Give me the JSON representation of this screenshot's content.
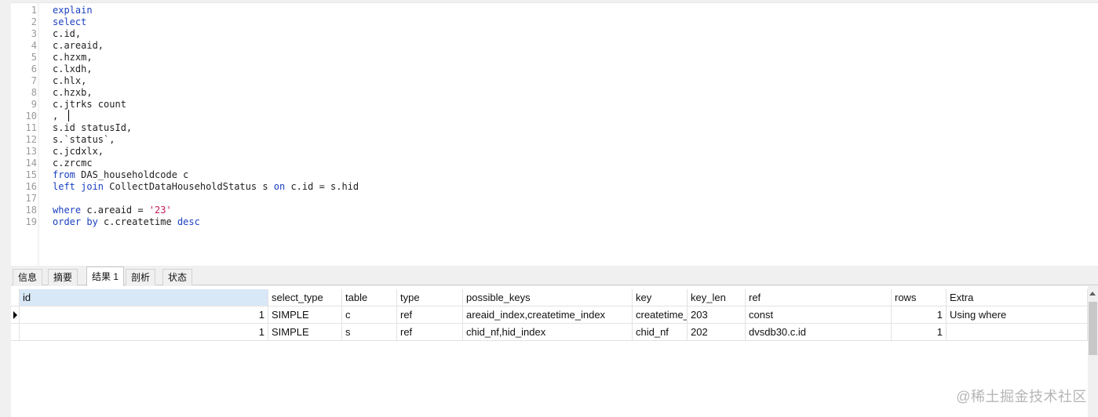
{
  "editor": {
    "line_numbers": [
      "1",
      "2",
      "3",
      "4",
      "5",
      "6",
      "7",
      "8",
      "9",
      "10",
      "11",
      "12",
      "13",
      "14",
      "15",
      "16",
      "17",
      "18",
      "19"
    ],
    "lines": [
      [
        {
          "t": "explain",
          "c": "kw"
        }
      ],
      [
        {
          "t": "select",
          "c": "kw"
        }
      ],
      [
        {
          "t": "c.id,",
          "c": ""
        }
      ],
      [
        {
          "t": "c.areaid,",
          "c": ""
        }
      ],
      [
        {
          "t": "c.hzxm,",
          "c": ""
        }
      ],
      [
        {
          "t": "c.lxdh,",
          "c": ""
        }
      ],
      [
        {
          "t": "c.hlx,",
          "c": ""
        }
      ],
      [
        {
          "t": "c.hzxb,",
          "c": ""
        }
      ],
      [
        {
          "t": "c.jtrks count",
          "c": ""
        }
      ],
      [
        {
          "t": ",",
          "c": ""
        }
      ],
      [
        {
          "t": "s.id statusId,",
          "c": ""
        }
      ],
      [
        {
          "t": "s.`status`,",
          "c": ""
        }
      ],
      [
        {
          "t": "c.jcdxlx,",
          "c": ""
        }
      ],
      [
        {
          "t": "c.zrcmc",
          "c": ""
        }
      ],
      [
        {
          "t": "from",
          "c": "kw"
        },
        {
          "t": " DAS_householdcode c",
          "c": ""
        }
      ],
      [
        {
          "t": "left join",
          "c": "kw"
        },
        {
          "t": " CollectDataHouseholdStatus s ",
          "c": ""
        },
        {
          "t": "on",
          "c": "kw"
        },
        {
          "t": " c.id = s.hid",
          "c": ""
        }
      ],
      [],
      [
        {
          "t": "where",
          "c": "kw"
        },
        {
          "t": " c.areaid = ",
          "c": ""
        },
        {
          "t": "'23'",
          "c": "str"
        }
      ],
      [
        {
          "t": "order by",
          "c": "kw"
        },
        {
          "t": " c.createtime ",
          "c": ""
        },
        {
          "t": "desc",
          "c": "kw"
        }
      ]
    ]
  },
  "tabs": [
    {
      "label": "信息",
      "active": false
    },
    {
      "label": "摘要",
      "active": false
    },
    {
      "label": "结果 1",
      "active": true
    },
    {
      "label": "剖析",
      "active": false
    },
    {
      "label": "状态",
      "active": false
    }
  ],
  "result_grid": {
    "columns": [
      "id",
      "select_type",
      "table",
      "type",
      "possible_keys",
      "key",
      "key_len",
      "ref",
      "rows",
      "Extra"
    ],
    "rows": [
      [
        "1",
        "SIMPLE",
        "c",
        "ref",
        "areaid_index,createtime_index",
        "createtime_",
        "203",
        "const",
        "1",
        "Using where"
      ],
      [
        "1",
        "SIMPLE",
        "s",
        "ref",
        "chid_nf,hid_index",
        "chid_nf",
        "202",
        "dvsdb30.c.id",
        "1",
        ""
      ]
    ]
  },
  "watermark": "@稀土掘金技术社区"
}
